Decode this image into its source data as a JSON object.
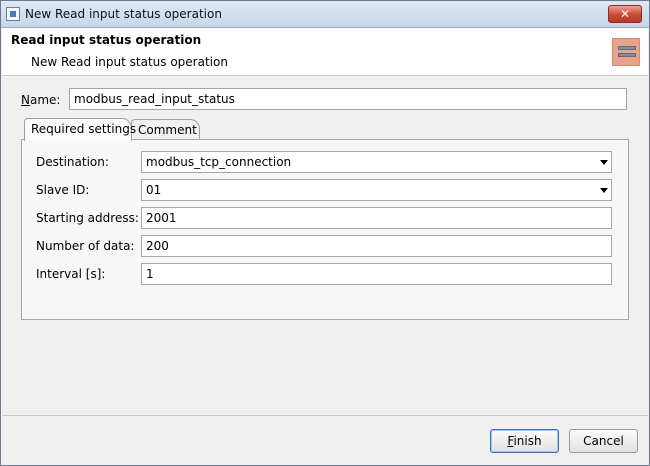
{
  "window": {
    "title": "New Read input status operation",
    "close_glyph": "✕"
  },
  "header": {
    "title": "Read input status operation",
    "subtitle": "New Read input status operation",
    "icon": "operation-icon"
  },
  "name": {
    "mnemonic": "N",
    "label_rest": "ame:",
    "value": "modbus_read_input_status"
  },
  "tabs": [
    {
      "label": "Required settings",
      "active": true
    },
    {
      "label": "Comment",
      "active": false
    }
  ],
  "fields": [
    {
      "label": "Destination:",
      "value": "modbus_tcp_connection",
      "type": "combo"
    },
    {
      "label": "Slave ID:",
      "value": "01",
      "type": "combo"
    },
    {
      "label": "Starting address:",
      "value": "2001",
      "type": "text"
    },
    {
      "label": "Number of data:",
      "value": "200",
      "type": "text"
    },
    {
      "label": "Interval [s]:",
      "value": "1",
      "type": "text"
    }
  ],
  "buttons": {
    "finish": {
      "mnemonic": "F",
      "rest": "inish"
    },
    "cancel": {
      "label": "Cancel"
    }
  }
}
